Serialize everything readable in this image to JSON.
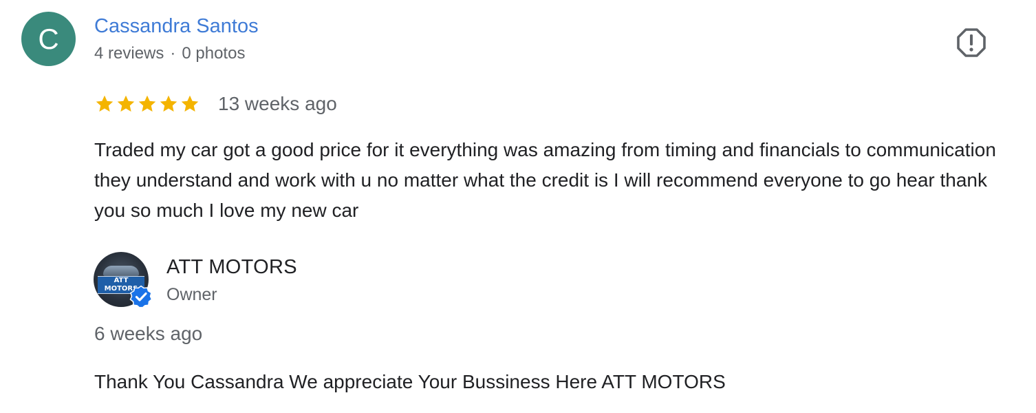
{
  "review": {
    "reviewer": {
      "avatar_letter": "C",
      "avatar_color": "#3a8a7c",
      "name": "Cassandra Santos",
      "reviews_count": "4 reviews",
      "separator": "·",
      "photos_count": "0 photos"
    },
    "report_icon": "report-octagon-icon",
    "rating": {
      "stars": 5,
      "max": 5,
      "star_color": "#f4b400"
    },
    "date": "13 weeks ago",
    "text": "Traded my car got a good price for it everything was amazing from timing and financials to communication they understand and work with u no matter what the credit is I will recommend everyone to go hear thank you so much I love my new car"
  },
  "owner_response": {
    "name": "ATT MOTORS",
    "role": "Owner",
    "verified_icon": "verified-badge-icon",
    "date": "6 weeks ago",
    "text": "Thank You Cassandra We appreciate Your Bussiness Here ATT MOTORS"
  },
  "colors": {
    "link_blue": "#3f7bd6",
    "text_primary": "#202124",
    "text_secondary": "#5f6368",
    "badge_blue": "#1a73e8"
  }
}
